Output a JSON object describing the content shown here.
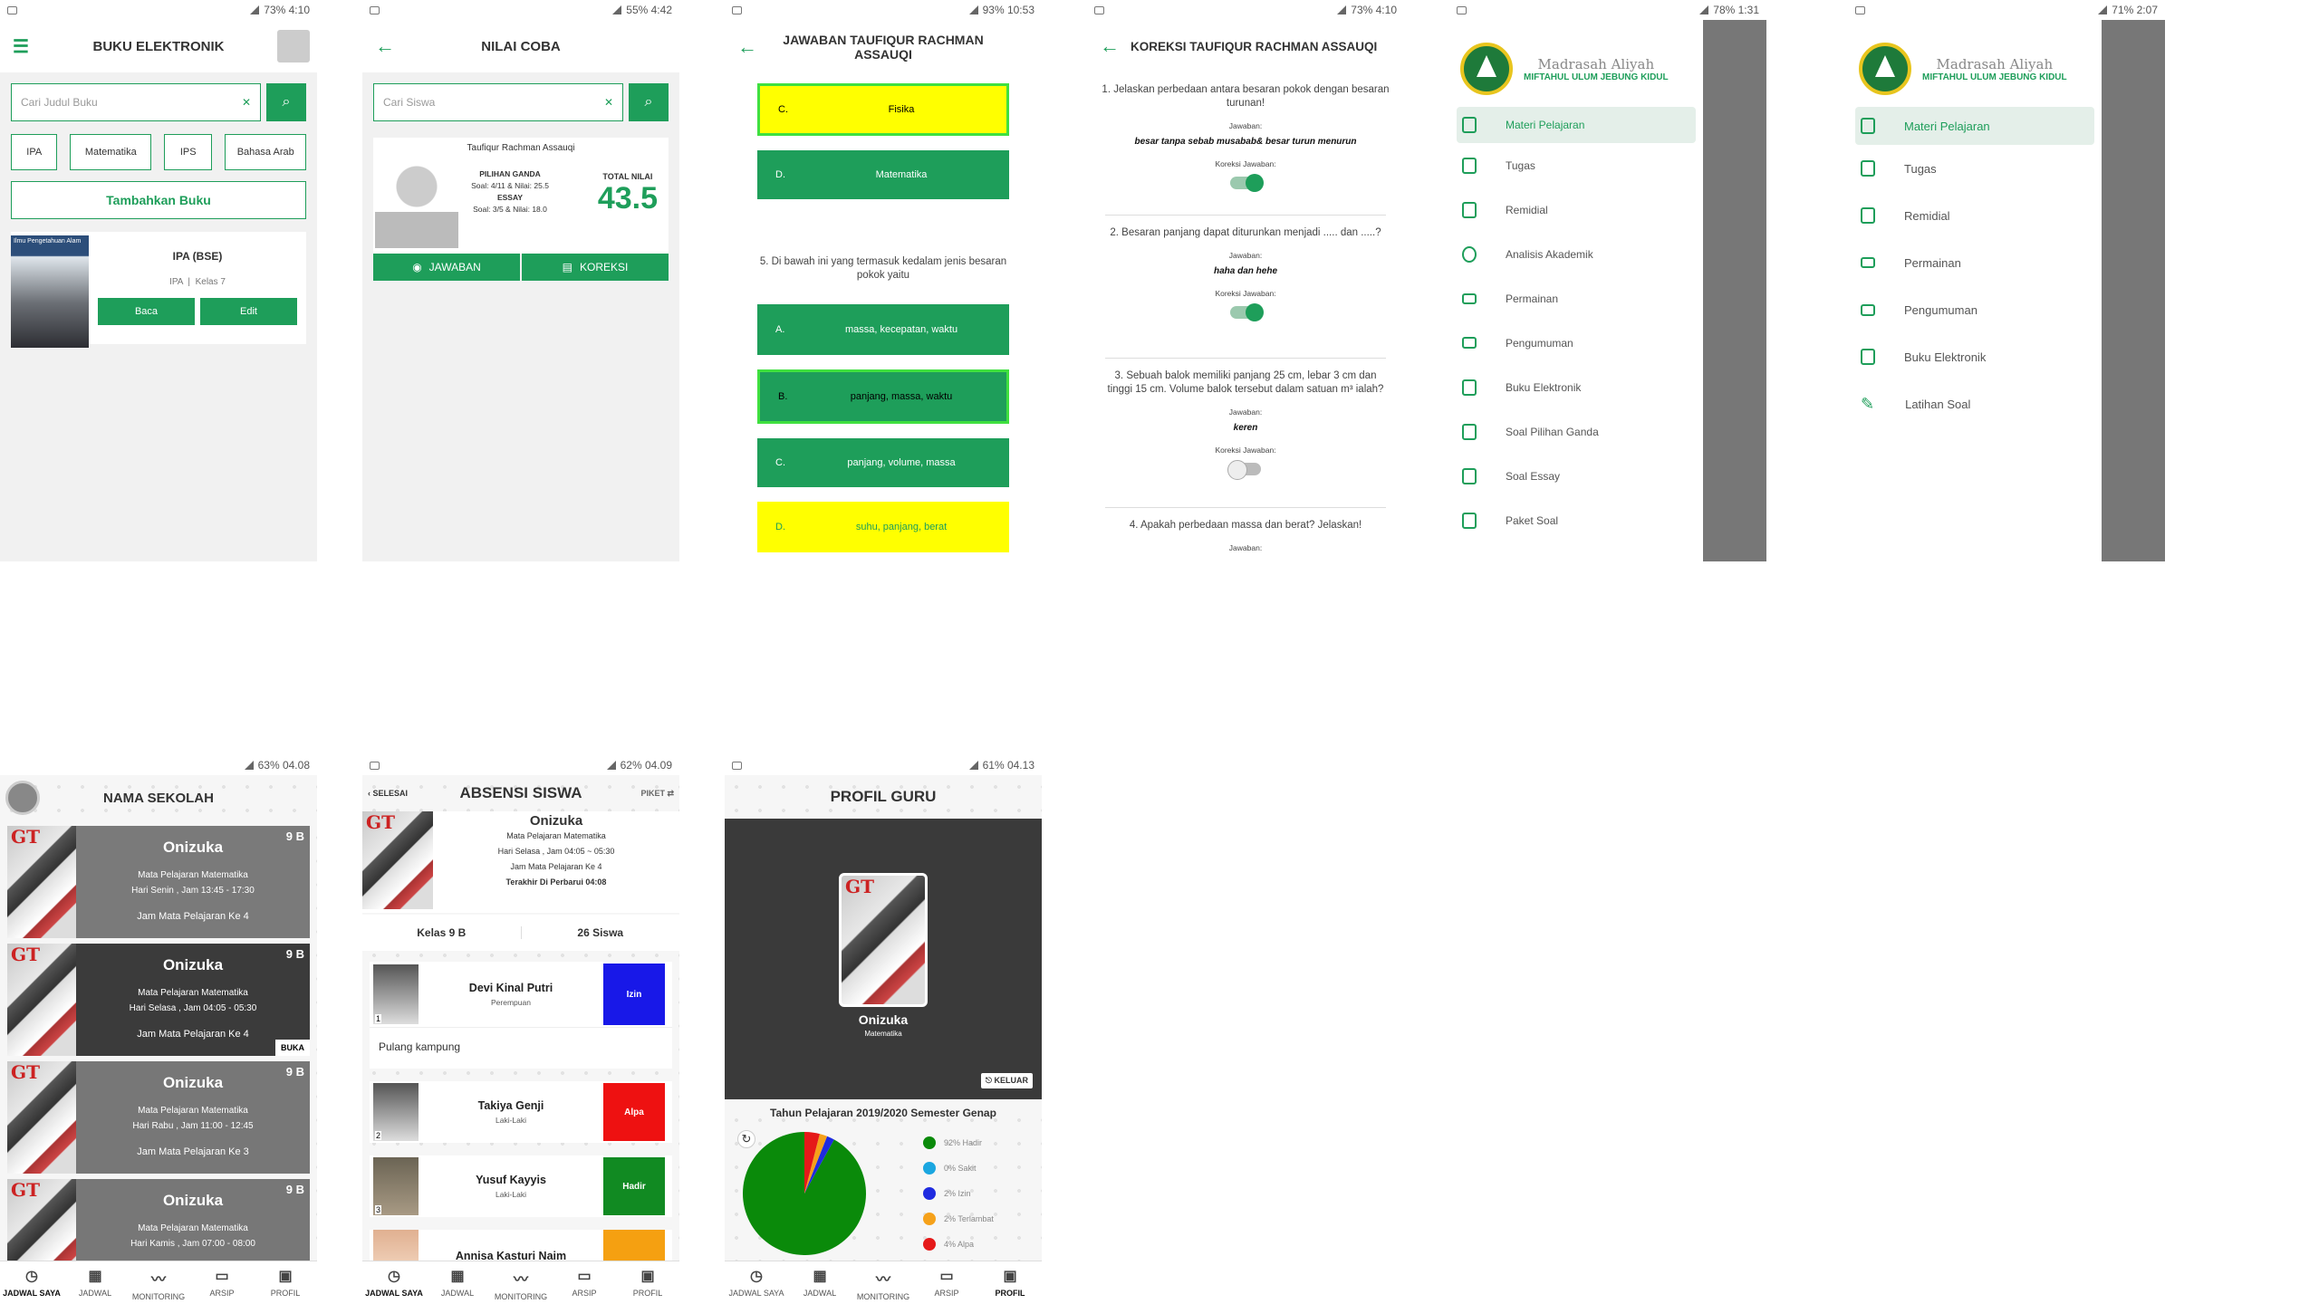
{
  "p1": {
    "status": "73% 4:10",
    "title": "BUKU ELEKTRONIK",
    "search_ph": "Cari Judul Buku",
    "chips": [
      "IPA",
      "Matematika",
      "IPS",
      "Bahasa Arab"
    ],
    "add": "Tambahkan Buku",
    "book": {
      "title": "IPA (BSE)",
      "subject": "IPA",
      "kelas": "Kelas 7",
      "cover_text": "Ilmu Pengetahuan Alam",
      "read": "Baca",
      "edit": "Edit"
    }
  },
  "p2": {
    "status": "55% 4:42",
    "title": "NILAI COBA",
    "search_ph": "Cari Siswa",
    "name": "Taufiqur Rachman Assauqi",
    "pg_label": "PILIHAN GANDA",
    "pg_val": "Soal: 4/11 & Nilai: 25.5",
    "es_label": "ESSAY",
    "es_val": "Soal: 3/5 & Nilai: 18.0",
    "total_label": "TOTAL NILAI",
    "total": "43.5",
    "b1": "JAWABAN",
    "b2": "KOREKSI"
  },
  "p3": {
    "status": "93% 10:53",
    "title": "JAWABAN TAUFIQUR RACHMAN ASSAUQI",
    "o1": [
      {
        "l": "C.",
        "v": "Fisika"
      },
      {
        "l": "D.",
        "v": "Matematika"
      }
    ],
    "q5": "5.  Di bawah ini yang termasuk kedalam jenis besaran pokok yaitu",
    "o2": [
      {
        "l": "A.",
        "v": "massa, kecepatan, waktu"
      },
      {
        "l": "B.",
        "v": "panjang, massa, waktu"
      },
      {
        "l": "C.",
        "v": "panjang, volume, massa"
      },
      {
        "l": "D.",
        "v": "suhu, panjang, berat"
      }
    ]
  },
  "p4": {
    "status": "73% 4:10",
    "title": "KOREKSI TAUFIQUR RACHMAN ASSAUQI",
    "jaw": "Jawaban:",
    "kor": "Koreksi Jawaban:",
    "qs": [
      {
        "q": "1.  Jelaskan perbedaan antara besaran pokok dengan besaran turunan!",
        "a": "besar tanpa sebab musabab& besar turun menurun"
      },
      {
        "q": "2.  Besaran panjang dapat diturunkan menjadi ..... dan .....?",
        "a": "haha dan hehe"
      },
      {
        "q": "3.  Sebuah balok memiliki panjang 25 cm, lebar 3 cm dan tinggi 15 cm. Volume balok tersebut dalam satuan m³ ialah?",
        "a": "keren"
      }
    ],
    "q4": "4.   Apakah perbedaan massa dan berat? Jelaskan!"
  },
  "p5": {
    "status": "78% 1:31",
    "school1": "Madrasah Aliyah",
    "school2": "MIFTAHUL ULUM JEBUNG KIDUL",
    "menu": [
      "Materi Pelajaran",
      "Tugas",
      "Remidial",
      "Analisis Akademik",
      "Permainan",
      "Pengumuman",
      "Buku Elektronik",
      "Soal Pilihan Ganda",
      "Soal Essay",
      "Paket Soal"
    ]
  },
  "p6": {
    "status": "71% 2:07",
    "school1": "Madrasah Aliyah",
    "school2": "MIFTAHUL ULUM JEBUNG KIDUL",
    "menu": [
      "Materi Pelajaran",
      "Tugas",
      "Remidial",
      "Permainan",
      "Pengumuman",
      "Buku Elektronik",
      "Latihan Soal"
    ]
  },
  "p7": {
    "status": "63% 04.08",
    "title": "NAMA SEKOLAH",
    "cards": [
      {
        "n": "Onizuka",
        "k": "9 B",
        "s1": "Mata Pelajaran Matematika",
        "s2": "Hari Senin , Jam 13:45 - 17:30",
        "s3": "Jam Mata Pelajaran Ke 4"
      },
      {
        "n": "Onizuka",
        "k": "9 B",
        "s1": "Mata Pelajaran Matematika",
        "s2": "Hari Selasa , Jam 04:05 - 05:30",
        "s3": "Jam Mata Pelajaran Ke 4",
        "tag": "BUKA"
      },
      {
        "n": "Onizuka",
        "k": "9 B",
        "s1": "Mata Pelajaran Matematika",
        "s2": "Hari Rabu , Jam 11:00 - 12:45",
        "s3": "Jam Mata Pelajaran Ke 3"
      },
      {
        "n": "Onizuka",
        "k": "9 B",
        "s1": "Mata Pelajaran Matematika",
        "s2": "Hari Kamis , Jam 07:00 - 08:00",
        "s3": ""
      }
    ],
    "nav": [
      "JADWAL SAYA",
      "JADWAL",
      "MONITORING",
      "ARSIP",
      "PROFIL"
    ]
  },
  "p8": {
    "status": "62% 04.09",
    "title": "ABSENSI SISWA",
    "left": "SELESAI",
    "right": "PIKET",
    "name": "Onizuka",
    "l1": "Mata Pelajaran Matematika",
    "l2": "Hari Selasa , Jam 04:05 ~ 05:30",
    "l3": "Jam Mata Pelajaran Ke 4",
    "l4": "Terakhir Di Perbarui 04:08",
    "kelas": "Kelas 9 B",
    "siswa": "26 Siswa",
    "note": "Pulang kampung",
    "students": [
      {
        "n": "Devi Kinal Putri",
        "g": "Perempuan",
        "s": "Izin",
        "no": "1"
      },
      {
        "n": "Takiya Genji",
        "g": "Laki-Laki",
        "s": "Alpa",
        "no": "2"
      },
      {
        "n": "Yusuf Kayyis",
        "g": "Laki-Laki",
        "s": "Hadir",
        "no": "3"
      },
      {
        "n": "Annisa Kasturi Naim",
        "g": "",
        "s": "",
        "no": ""
      }
    ],
    "nav": [
      "JADWAL SAYA",
      "JADWAL",
      "MONITORING",
      "ARSIP",
      "PROFIL"
    ]
  },
  "p9": {
    "status": "61% 04.13",
    "title": "PROFIL GURU",
    "name": "Onizuka",
    "subject": "Matematika",
    "logout": "KELUAR",
    "chart_title": "Tahun Pelajaran 2019/2020 Semester Genap",
    "nav": [
      "JADWAL SAYA",
      "JADWAL",
      "MONITORING",
      "ARSIP",
      "PROFIL"
    ]
  },
  "chart_data": {
    "type": "pie",
    "title": "Tahun Pelajaran 2019/2020 Semester Genap",
    "categories": [
      "Hadir",
      "Sakit",
      "Izin",
      "Terlambat",
      "Alpa"
    ],
    "values": [
      92,
      0,
      2,
      2,
      4
    ],
    "labels": [
      "92% Hadir",
      "0% Sakit",
      "2% Izin",
      "2% Terlambat",
      "4% Alpa"
    ],
    "colors": [
      "#0a8a0a",
      "#1aa6e0",
      "#1f2be0",
      "#f5a11a",
      "#e51919"
    ],
    "legend": "right"
  }
}
